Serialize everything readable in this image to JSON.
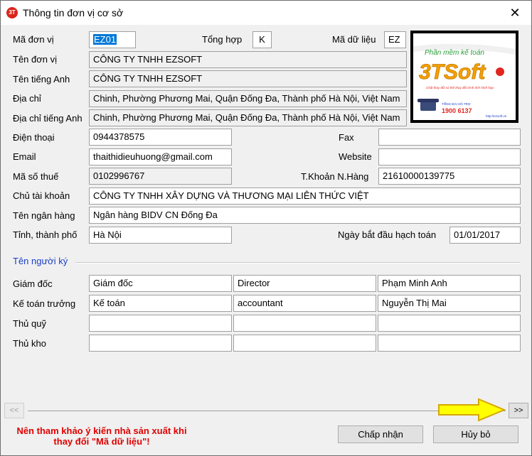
{
  "window": {
    "title": "Thông tin đơn vị cơ sở"
  },
  "form": {
    "ma_don_vi": {
      "label": "Mã đơn vị",
      "value": "EZ01"
    },
    "tong_hop": {
      "label": "Tổng hợp",
      "value": "K"
    },
    "ma_du_lieu": {
      "label": "Mã dữ liệu",
      "value": "EZ"
    },
    "ten_don_vi": {
      "label": "Tên đơn vị",
      "value": "CÔNG TY TNHH EZSOFT"
    },
    "ten_tieng_anh": {
      "label": "Tên tiếng Anh",
      "value": "CÔNG TY TNHH EZSOFT"
    },
    "dia_chi": {
      "label": "Địa chỉ",
      "value": "Chinh, Phường Phương Mai, Quận Đống Đa, Thành phố Hà Nội, Việt Nam"
    },
    "dia_chi_tieng_anh": {
      "label": "Địa chỉ tiếng Anh",
      "value": "Chinh, Phường Phương Mai, Quận Đống Đa, Thành phố Hà Nội, Việt Nam"
    },
    "dien_thoai": {
      "label": "Điện thoại",
      "value": "0944378575"
    },
    "fax": {
      "label": "Fax",
      "value": ""
    },
    "email": {
      "label": "Email",
      "value": "thaithidieuhuong@gmail.com"
    },
    "website": {
      "label": "Website",
      "value": ""
    },
    "ma_so_thue": {
      "label": "Mã số thuế",
      "value": "0102996767"
    },
    "tai_khoan": {
      "label": "T.Khoản N.Hàng",
      "value": "21610000139775"
    },
    "chu_tai_khoan": {
      "label": "Chủ tài khoản",
      "value": "CÔNG TY TNHH XÂY DỰNG VÀ THƯƠNG MẠI LIÊN THỨC VIỆT"
    },
    "ten_ngan_hang": {
      "label": "Tên ngân hàng",
      "value": "Ngân hàng BIDV CN Đống Đa"
    },
    "tinh_thanh_pho": {
      "label": "Tỉnh, thành phố",
      "value": "Hà Nội"
    },
    "ngay_bat_dau": {
      "label": "Ngày bắt đầu hạch toán",
      "value": "01/01/2017"
    }
  },
  "signers": {
    "section_label": "Tên người ký",
    "rows": [
      {
        "label": "Giám đốc",
        "title_vi": "Giám đốc",
        "title_en": "Director",
        "name": "Phạm Minh Anh"
      },
      {
        "label": "Kế toán trưởng",
        "title_vi": "Kế toán",
        "title_en": "accountant",
        "name": "Nguyễn Thị Mai"
      },
      {
        "label": "Thủ quỹ",
        "title_vi": "",
        "title_en": "",
        "name": ""
      },
      {
        "label": "Thủ kho",
        "title_vi": "",
        "title_en": "",
        "name": ""
      }
    ]
  },
  "logo": {
    "tagline": "Phần mềm kế toán",
    "brand": "3TSoft",
    "subtext": "Chất thay đổi có thể thay đổi trình tính hình hợp",
    "hotline_label": "TỔNG ĐÀI HỖ TRỢ",
    "hotline": "1900 6137",
    "url": "http://ezsoft.vn"
  },
  "nav": {
    "prev_label": "<<",
    "next_label": ">>"
  },
  "footer": {
    "warning": "Nên tham khảo ý kiến nhà sản xuất khi thay đổi \"Mã dữ liệu\"!",
    "accept_label": "Chấp nhận",
    "cancel_label": "Hủy bỏ"
  },
  "colors": {
    "section_label": "#1a3fc4",
    "warning": "#e00000",
    "arrow_fill": "#ffff00",
    "arrow_stroke": "#d4a800",
    "logo_brand": "#f5a000"
  }
}
